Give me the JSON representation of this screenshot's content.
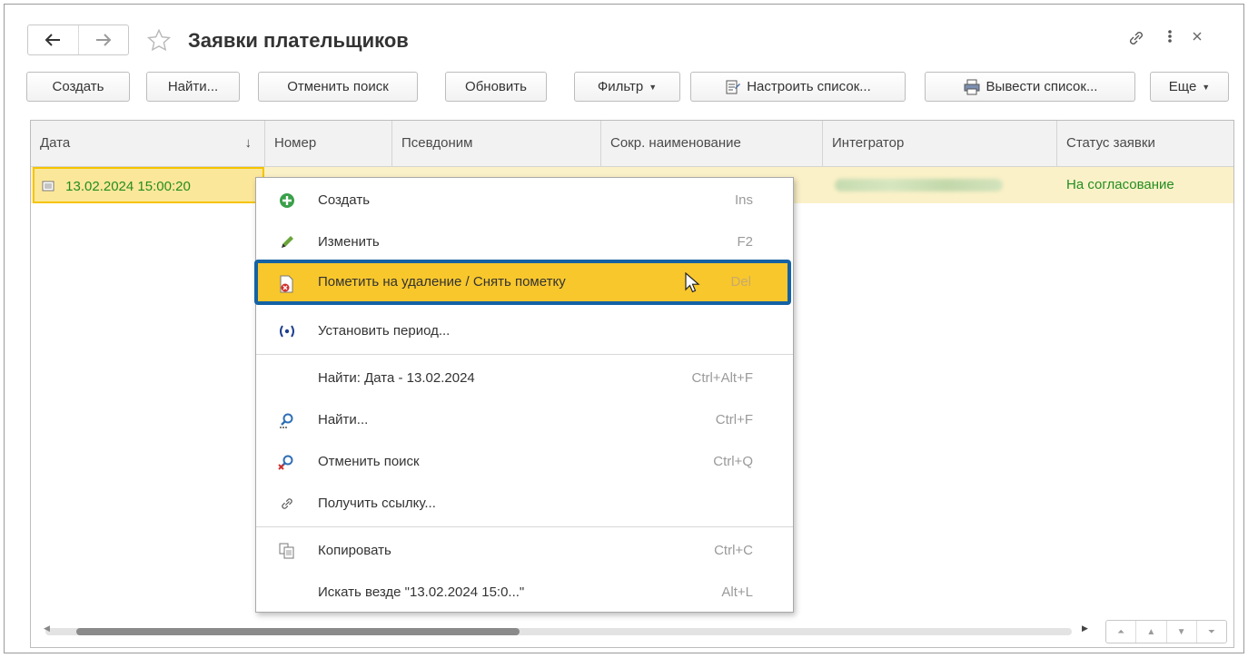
{
  "window": {
    "title": "Заявки плательщиков"
  },
  "toolbar": {
    "create": "Создать",
    "find": "Найти...",
    "cancel_search": "Отменить поиск",
    "refresh": "Обновить",
    "filter": "Фильтр",
    "configure_list": "Настроить список...",
    "export_list": "Вывести список...",
    "more": "Еще"
  },
  "table": {
    "columns": [
      "Дата",
      "Номер",
      "Псевдоним",
      "Сокр. наименование",
      "Интегратор",
      "Статус заявки"
    ],
    "sort_indicator": "↓",
    "rows": [
      {
        "date": "13.02.2024 15:00:20",
        "status": "На согласование"
      }
    ]
  },
  "context_menu": {
    "items": [
      {
        "label": "Создать",
        "shortcut": "Ins",
        "icon": "plus-circle-icon"
      },
      {
        "label": "Изменить",
        "shortcut": "F2",
        "icon": "pencil-icon"
      },
      {
        "label": "Пометить на удаление / Снять пометку",
        "shortcut": "Del",
        "icon": "delete-mark-icon"
      },
      {
        "label": "Установить период...",
        "shortcut": "",
        "icon": "period-icon"
      },
      {
        "label": "Найти: Дата - 13.02.2024",
        "shortcut": "Ctrl+Alt+F",
        "icon": ""
      },
      {
        "label": "Найти...",
        "shortcut": "Ctrl+F",
        "icon": "search-icon"
      },
      {
        "label": "Отменить поиск",
        "shortcut": "Ctrl+Q",
        "icon": "cancel-search-icon"
      },
      {
        "label": "Получить ссылку...",
        "shortcut": "",
        "icon": "link-icon"
      },
      {
        "label": "Копировать",
        "shortcut": "Ctrl+C",
        "icon": "copy-icon"
      },
      {
        "label": "Искать везде \"13.02.2024 15:0...\"",
        "shortcut": "Alt+L",
        "icon": ""
      }
    ]
  },
  "colors": {
    "status_green": "#238d1f",
    "highlight_fill": "#f8c72c",
    "highlight_border": "#1462a3",
    "row_selected": "#fbf1c8"
  }
}
